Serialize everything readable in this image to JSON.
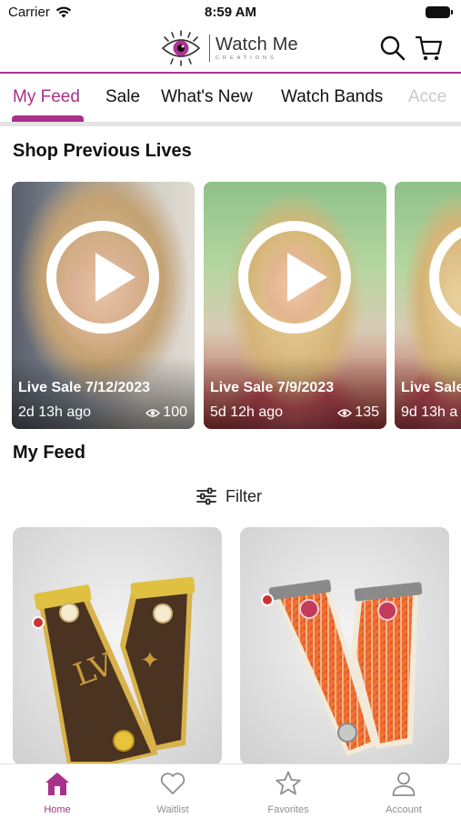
{
  "status": {
    "carrier": "Carrier",
    "time": "8:59 AM"
  },
  "header": {
    "logo_title": "Watch Me",
    "logo_sub": "CREATIONS",
    "accent_color": "#a8318a"
  },
  "tabs": [
    {
      "label": "My Feed",
      "active": true
    },
    {
      "label": "Sale"
    },
    {
      "label": "What's New"
    },
    {
      "label": "Watch Bands"
    },
    {
      "label": "Acce"
    }
  ],
  "previous_lives": {
    "title": "Shop Previous Lives",
    "items": [
      {
        "title": "Live Sale 7/12/2023",
        "ago": "2d 13h ago",
        "views": "100"
      },
      {
        "title": "Live Sale 7/9/2023",
        "ago": "5d 12h ago",
        "views": "135"
      },
      {
        "title": "Live Sale",
        "ago": "9d 13h a",
        "views": ""
      }
    ]
  },
  "feed": {
    "title": "My Feed",
    "filter_label": "Filter",
    "products": [
      {
        "image_icon": "brown-monogram-watch-band"
      },
      {
        "image_icon": "red-tweed-watch-band"
      }
    ]
  },
  "tabbar": {
    "items": [
      {
        "label": "Home",
        "icon": "home-icon",
        "active": true
      },
      {
        "label": "Waitlist",
        "icon": "heart-icon"
      },
      {
        "label": "Favorites",
        "icon": "star-icon"
      },
      {
        "label": "Account",
        "icon": "person-icon"
      }
    ]
  }
}
